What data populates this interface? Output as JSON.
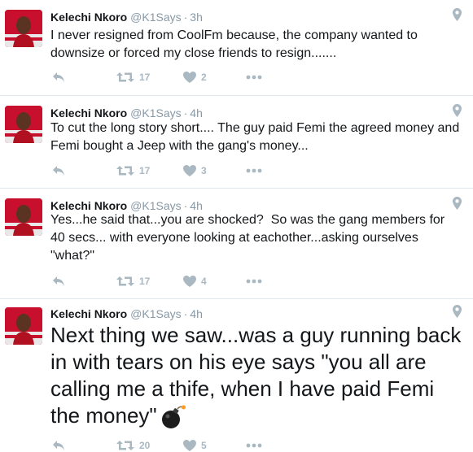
{
  "icons": {
    "reply": "reply-icon",
    "retweet": "retweet-icon",
    "like": "heart-icon",
    "more": "more-icon",
    "location": "location-pin-icon",
    "avatar": "avatar",
    "emoji": "bomb-emoji-icon"
  },
  "colors": {
    "muted": "#8899a6",
    "action": "#aab8c2",
    "divider": "#e1e8ed",
    "text": "#14171a"
  },
  "tweets": [
    {
      "name": "Kelechi Nkoro",
      "handle": "@K1Says",
      "separator": "·",
      "time": "3h",
      "text": "I never resigned from CoolFm because, the company wanted to downsize or forced my close friends to resign.......",
      "retweets": "17",
      "likes": "2"
    },
    {
      "name": "Kelechi Nkoro",
      "handle": "@K1Says",
      "separator": "·",
      "time": "4h",
      "text": "To cut the long story short.... The guy paid Femi the agreed money and Femi bought a Jeep with the gang's money...",
      "retweets": "17",
      "likes": "3"
    },
    {
      "name": "Kelechi Nkoro",
      "handle": "@K1Says",
      "separator": "·",
      "time": "4h",
      "text": "Yes...he said that...you are shocked?  So was the gang members for 40 secs... with everyone looking at eachother...asking ourselves \"what?\"",
      "retweets": "17",
      "likes": "4"
    },
    {
      "name": "Kelechi Nkoro",
      "handle": "@K1Says",
      "separator": "·",
      "time": "4h",
      "text": "Next thing we saw...was a guy running back in with tears on his eye says \"you all are calling me a thife, when I have paid Femi the money\"",
      "retweets": "20",
      "likes": "5"
    }
  ]
}
